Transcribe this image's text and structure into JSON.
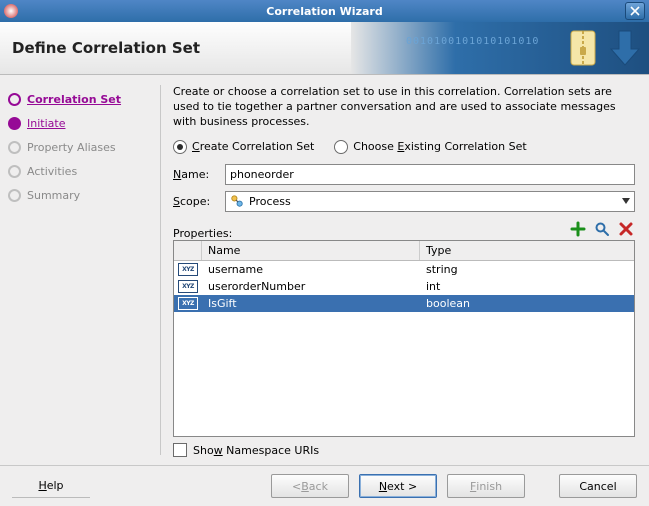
{
  "title": "Correlation Wizard",
  "header": {
    "title": "Define Correlation Set"
  },
  "sidebar": {
    "steps": [
      {
        "label": "Correlation Set",
        "state": "done"
      },
      {
        "label": "Initiate",
        "state": "cur"
      },
      {
        "label": "Property Aliases",
        "state": "todo"
      },
      {
        "label": "Activities",
        "state": "todo"
      },
      {
        "label": "Summary",
        "state": "todo"
      }
    ]
  },
  "main": {
    "intro": "Create or choose a correlation set to use in this correlation. Correlation sets are used to tie together a partner conversation and are used to associate messages with business processes.",
    "radios": {
      "create": {
        "u": "C",
        "rest": "reate Correlation Set"
      },
      "choose": {
        "pre": "Choose ",
        "u": "E",
        "rest": "xisting Correlation Set"
      }
    },
    "name": {
      "label_u": "N",
      "label_rest": "ame:",
      "value": "phoneorder"
    },
    "scope": {
      "label_u": "S",
      "label_rest": "cope:",
      "value": "Process"
    },
    "properties_label_u": "P",
    "properties_label_rest": "roperties:",
    "columns": {
      "name": "Name",
      "type": "Type"
    },
    "rows": [
      {
        "name": "username",
        "type": "string",
        "selected": false
      },
      {
        "name": "userorderNumber",
        "type": "int",
        "selected": false
      },
      {
        "name": "IsGift",
        "type": "boolean",
        "selected": true
      }
    ],
    "show_ns": {
      "pre": "Sho",
      "u": "w",
      "rest": " Namespace URIs"
    }
  },
  "footer": {
    "help": {
      "u": "H",
      "rest": "elp"
    },
    "back": {
      "pre": "< ",
      "u": "B",
      "rest": "ack"
    },
    "next": {
      "u": "N",
      "rest": "ext >"
    },
    "finish": {
      "u": "F",
      "rest": "inish"
    },
    "cancel": "Cancel"
  }
}
